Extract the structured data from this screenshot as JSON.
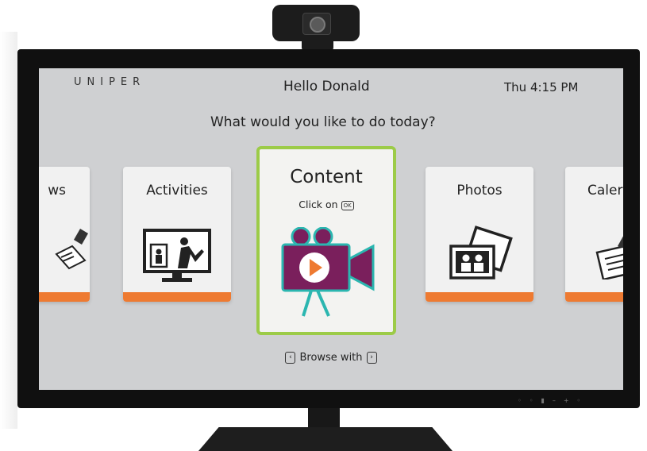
{
  "header": {
    "brand": "UNIPER",
    "greeting": "Hello Donald",
    "clock": "Thu 4:15 PM"
  },
  "prompt": "What would you like to do today?",
  "tiles": [
    {
      "label": "ws",
      "icon": "news-icon"
    },
    {
      "label": "Activities",
      "icon": "activities-icon"
    },
    {
      "label": "Content",
      "icon": "video-camera-icon",
      "selected": true
    },
    {
      "label": "Photos",
      "icon": "photos-icon"
    },
    {
      "label": "Caler",
      "icon": "calendar-icon"
    }
  ],
  "content_tile": {
    "hint": "Click on",
    "key": "OK"
  },
  "browse": {
    "label": "Browse with",
    "left_key": "‹",
    "right_key": "›"
  },
  "colors": {
    "accent_bar": "#ee7a31",
    "selected_border": "#9ccb48",
    "camera_body": "#7a1f5c",
    "camera_outline": "#2bb6b0"
  }
}
